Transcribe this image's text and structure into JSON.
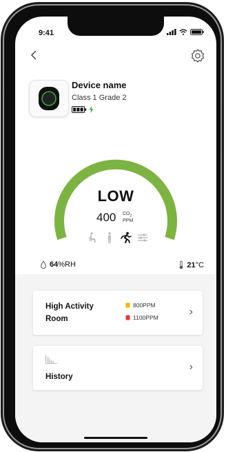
{
  "status_bar": {
    "time": "9:41"
  },
  "device": {
    "name": "Device name",
    "class": "Class 1 Grade 2"
  },
  "gauge": {
    "level": "LOW",
    "value": "400",
    "unit_top": "CO",
    "unit_sub": "2",
    "unit_bottom": "PPM",
    "color": "#7cb342",
    "fill_fraction": 1.0
  },
  "activity_levels": [
    {
      "icon": "seated-person-icon",
      "active": false
    },
    {
      "icon": "standing-person-icon",
      "active": false
    },
    {
      "icon": "running-person-icon",
      "active": true
    },
    {
      "icon": "sliders-icon",
      "active": false
    }
  ],
  "environment": {
    "humidity_value": "64",
    "humidity_unit": "%RH",
    "temperature_value": "21",
    "temperature_unit": "°C"
  },
  "cards": {
    "activity": {
      "title_line1": "High Activity",
      "title_line2": "Room",
      "warning_threshold": "800PPM",
      "alert_threshold": "1100PPM",
      "warning_color": "#f5b400",
      "alert_color": "#e53935"
    },
    "history": {
      "title": "History"
    }
  }
}
